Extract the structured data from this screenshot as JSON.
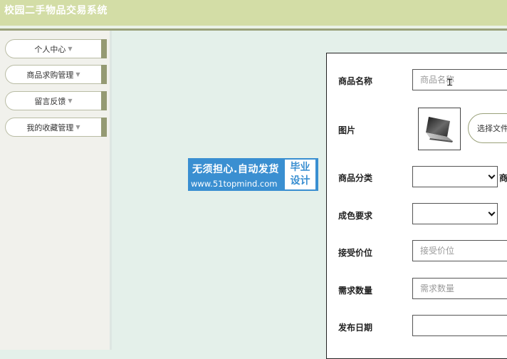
{
  "app": {
    "title": "校园二手物品交易系统"
  },
  "sidebar": {
    "items": [
      {
        "label": "个人中心"
      },
      {
        "label": "商品求购管理"
      },
      {
        "label": "留言反馈"
      },
      {
        "label": "我的收藏管理"
      }
    ]
  },
  "watermark": {
    "line1": "无须担心.自动发货",
    "line2": "www.51topmind.com",
    "box_line1": "毕业",
    "box_line2": "设计"
  },
  "form": {
    "product_name": {
      "label": "商品名称",
      "placeholder": "商品名称",
      "value": ""
    },
    "image": {
      "label": "图片",
      "button_label": "选择文件"
    },
    "category": {
      "label": "商品分类",
      "selected": "",
      "trailing_label": "商"
    },
    "condition": {
      "label": "成色要求",
      "selected": ""
    },
    "accept_price": {
      "label": "接受价位",
      "placeholder": "接受价位",
      "value": ""
    },
    "quantity": {
      "label": "需求数量",
      "placeholder": "需求数量",
      "value": ""
    },
    "publish_date": {
      "label": "发布日期",
      "value": ""
    }
  },
  "colors": {
    "header_bg": "#d3dda6",
    "accent_tab": "#959a73",
    "content_bg": "#e4f0ea",
    "watermark_blue": "#3a8fd1"
  },
  "icons": {
    "menu_caret": "caret-down-icon",
    "select_chevron": "chevron-down-icon",
    "product_image": "laptop-image"
  }
}
